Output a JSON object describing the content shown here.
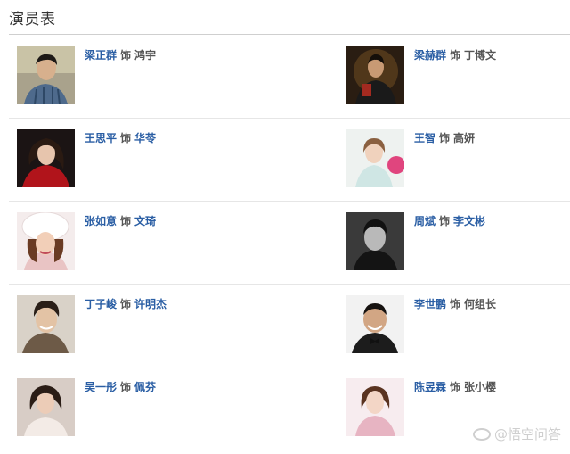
{
  "title": "演员表",
  "connector": "饰",
  "rows": [
    {
      "left": {
        "actor": "梁正群",
        "role": "鸿宇",
        "role_linked": false,
        "photo": "actor-photo-man-plaid-shirt"
      },
      "right": {
        "actor": "梁赫群",
        "role": "丁博文",
        "role_linked": false,
        "photo": "actor-photo-man-dark-stage"
      }
    },
    {
      "left": {
        "actor": "王思平",
        "role": "华苓",
        "role_linked": true,
        "photo": "actor-photo-woman-red-dress"
      },
      "right": {
        "actor": "王智",
        "role": "高妍",
        "role_linked": false,
        "photo": "actor-photo-woman-balloon"
      }
    },
    {
      "left": {
        "actor": "张如意",
        "role": "文琦",
        "role_linked": true,
        "photo": "actor-photo-woman-fur-hat"
      },
      "right": {
        "actor": "周斌",
        "role": "李文彬",
        "role_linked": true,
        "photo": "actor-photo-man-bw-portrait"
      }
    },
    {
      "left": {
        "actor": "丁子峻",
        "role": "许明杰",
        "role_linked": true,
        "photo": "actor-photo-man-smiling"
      },
      "right": {
        "actor": "李世鹏",
        "role": "何组长",
        "role_linked": false,
        "photo": "actor-photo-man-bowtie"
      }
    },
    {
      "left": {
        "actor": "吴一彤",
        "role": "佩芬",
        "role_linked": true,
        "photo": "actor-photo-woman-white-top"
      },
      "right": {
        "actor": "陈昱霖",
        "role": "张小樱",
        "role_linked": false,
        "photo": "actor-photo-woman-pink-dress"
      }
    }
  ],
  "watermark": "@悟空问答",
  "colors": {
    "link": "#2a5ea4",
    "text": "#555555",
    "divider": "#e6e6e6"
  }
}
